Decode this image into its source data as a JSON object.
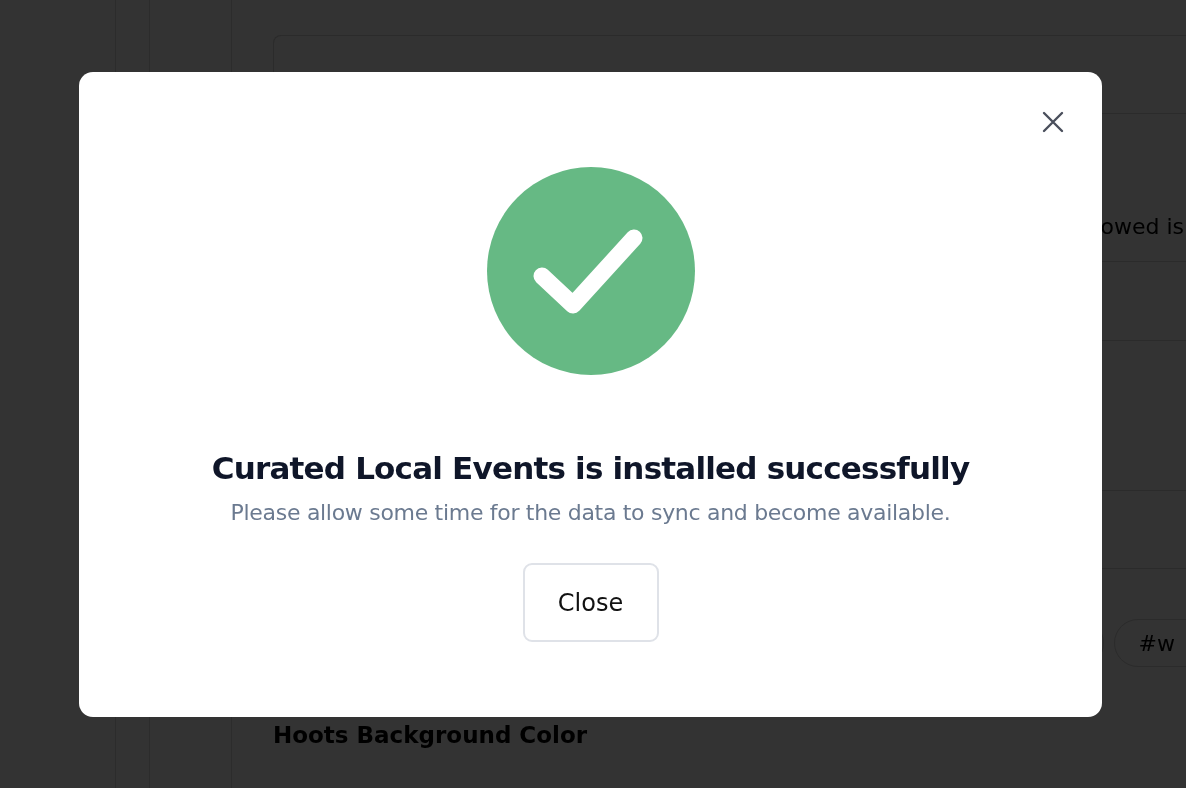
{
  "background": {
    "row_text": "owed is",
    "tag": "#w",
    "section_heading": "Hoots Background Color"
  },
  "dialog": {
    "title": "Curated Local Events is installed successfully",
    "message": "Please allow some time for the data to sync and become available.",
    "button": "Close"
  }
}
